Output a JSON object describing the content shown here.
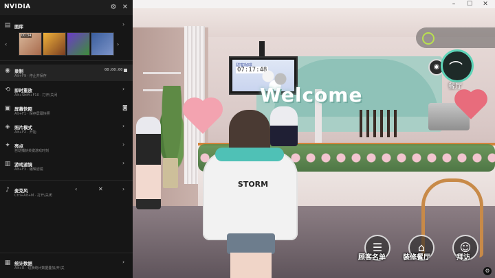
{
  "panel": {
    "brand": "NVIDIA",
    "gallery": {
      "title": "图库",
      "first_thumb_time": "00:34"
    },
    "rows": {
      "record": {
        "title": "录制",
        "sub": "Alt+F9 · 停止并保存",
        "time": "00:00:00"
      },
      "instant_replay": {
        "title": "即时重放",
        "sub": "Alt+Shift+F10 · 打开/关闭"
      },
      "screenshot": {
        "title": "屏幕快照",
        "sub": "Alt+F1 · 保存屏幕快照"
      },
      "photo_mode": {
        "title": "照片模式",
        "sub": "Alt+F2 · 开始"
      },
      "highlights": {
        "title": "亮点",
        "sub": "自动捕获关键游戏时刻"
      },
      "game_filter": {
        "title": "游戏滤镜",
        "sub": "Alt+F3 · 编辑滤镜"
      },
      "microphone": {
        "title": "麦克风",
        "sub": "Ctrl+Alt+M · 打开/关闭"
      },
      "stats": {
        "title": "统计数据",
        "sub": "Alt+R · 切换统计数据叠加/开/关"
      }
    }
  },
  "game": {
    "tv": {
      "title": "甜蜜咖啡",
      "time": "07:17:48"
    },
    "welcome": "Welcome",
    "player_shirt": "STORM",
    "hud": {
      "restaurant_label": "餐厅",
      "bottom_buttons": [
        {
          "label": "顾客名单",
          "icon": "list-icon"
        },
        {
          "label": "装修餐厅",
          "icon": "hammer-icon"
        },
        {
          "label": "拜访",
          "icon": "visit-icon"
        }
      ]
    }
  }
}
